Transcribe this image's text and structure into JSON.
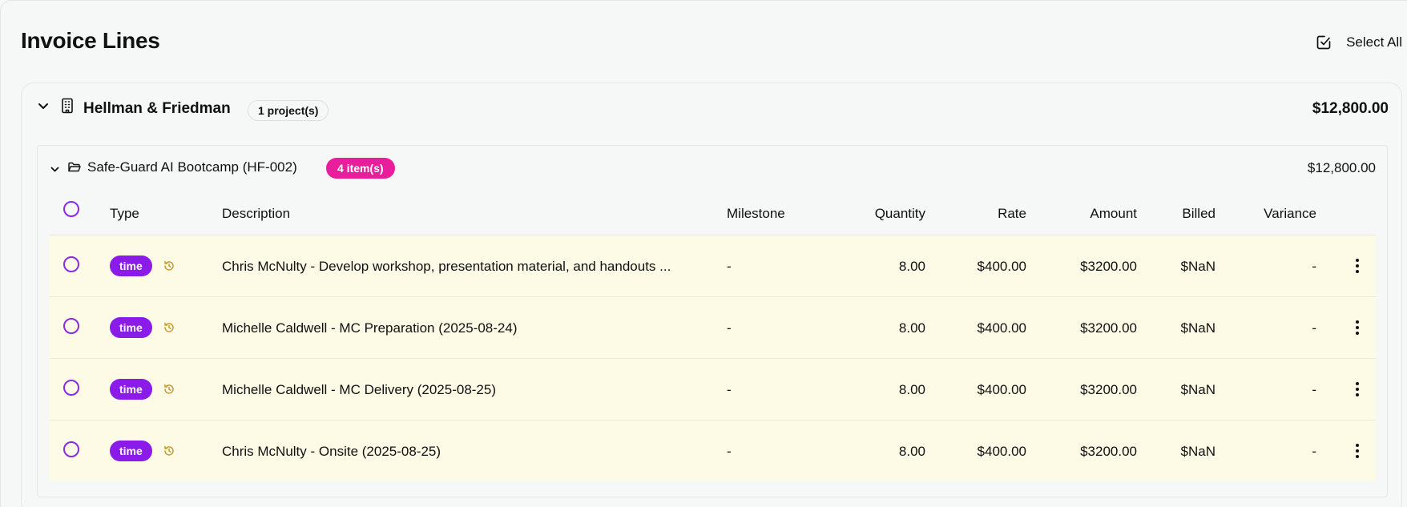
{
  "page": {
    "title": "Invoice Lines",
    "select_all_label": "Select All"
  },
  "client": {
    "name": "Hellman & Friedman",
    "project_count": "1 project(s)",
    "total": "$12,800.00"
  },
  "project": {
    "name": "Safe-Guard AI Bootcamp (HF-002)",
    "item_count": "4 item(s)",
    "total": "$12,800.00"
  },
  "table": {
    "headers": {
      "type": "Type",
      "description": "Description",
      "milestone": "Milestone",
      "quantity": "Quantity",
      "rate": "Rate",
      "amount": "Amount",
      "billed": "Billed",
      "variance": "Variance"
    },
    "rows": [
      {
        "type": "time",
        "description": "Chris McNulty - Develop workshop, presentation material, and handouts ...",
        "milestone": "-",
        "quantity": "8.00",
        "rate": "$400.00",
        "amount": "$3200.00",
        "billed": "$NaN",
        "variance": "-"
      },
      {
        "type": "time",
        "description": "Michelle Caldwell - MC Preparation (2025-08-24)",
        "milestone": "-",
        "quantity": "8.00",
        "rate": "$400.00",
        "amount": "$3200.00",
        "billed": "$NaN",
        "variance": "-"
      },
      {
        "type": "time",
        "description": "Michelle Caldwell - MC Delivery (2025-08-25)",
        "milestone": "-",
        "quantity": "8.00",
        "rate": "$400.00",
        "amount": "$3200.00",
        "billed": "$NaN",
        "variance": "-"
      },
      {
        "type": "time",
        "description": "Chris McNulty - Onsite (2025-08-25)",
        "milestone": "-",
        "quantity": "8.00",
        "rate": "$400.00",
        "amount": "$3200.00",
        "billed": "$NaN",
        "variance": "-"
      }
    ]
  },
  "colors": {
    "accent_purple": "#8a1be8",
    "item_badge_pink": "#e81e9c",
    "row_highlight": "#fdfae6",
    "history_icon": "#c99a2e"
  },
  "icons": {
    "select_all": "checkbox-icon",
    "client_toggle": "chevron-down-icon",
    "client": "building-icon",
    "project_toggle": "chevron-down-icon",
    "project": "folder-icon",
    "row_history": "history-icon",
    "row_menu": "more-vertical-icon"
  }
}
